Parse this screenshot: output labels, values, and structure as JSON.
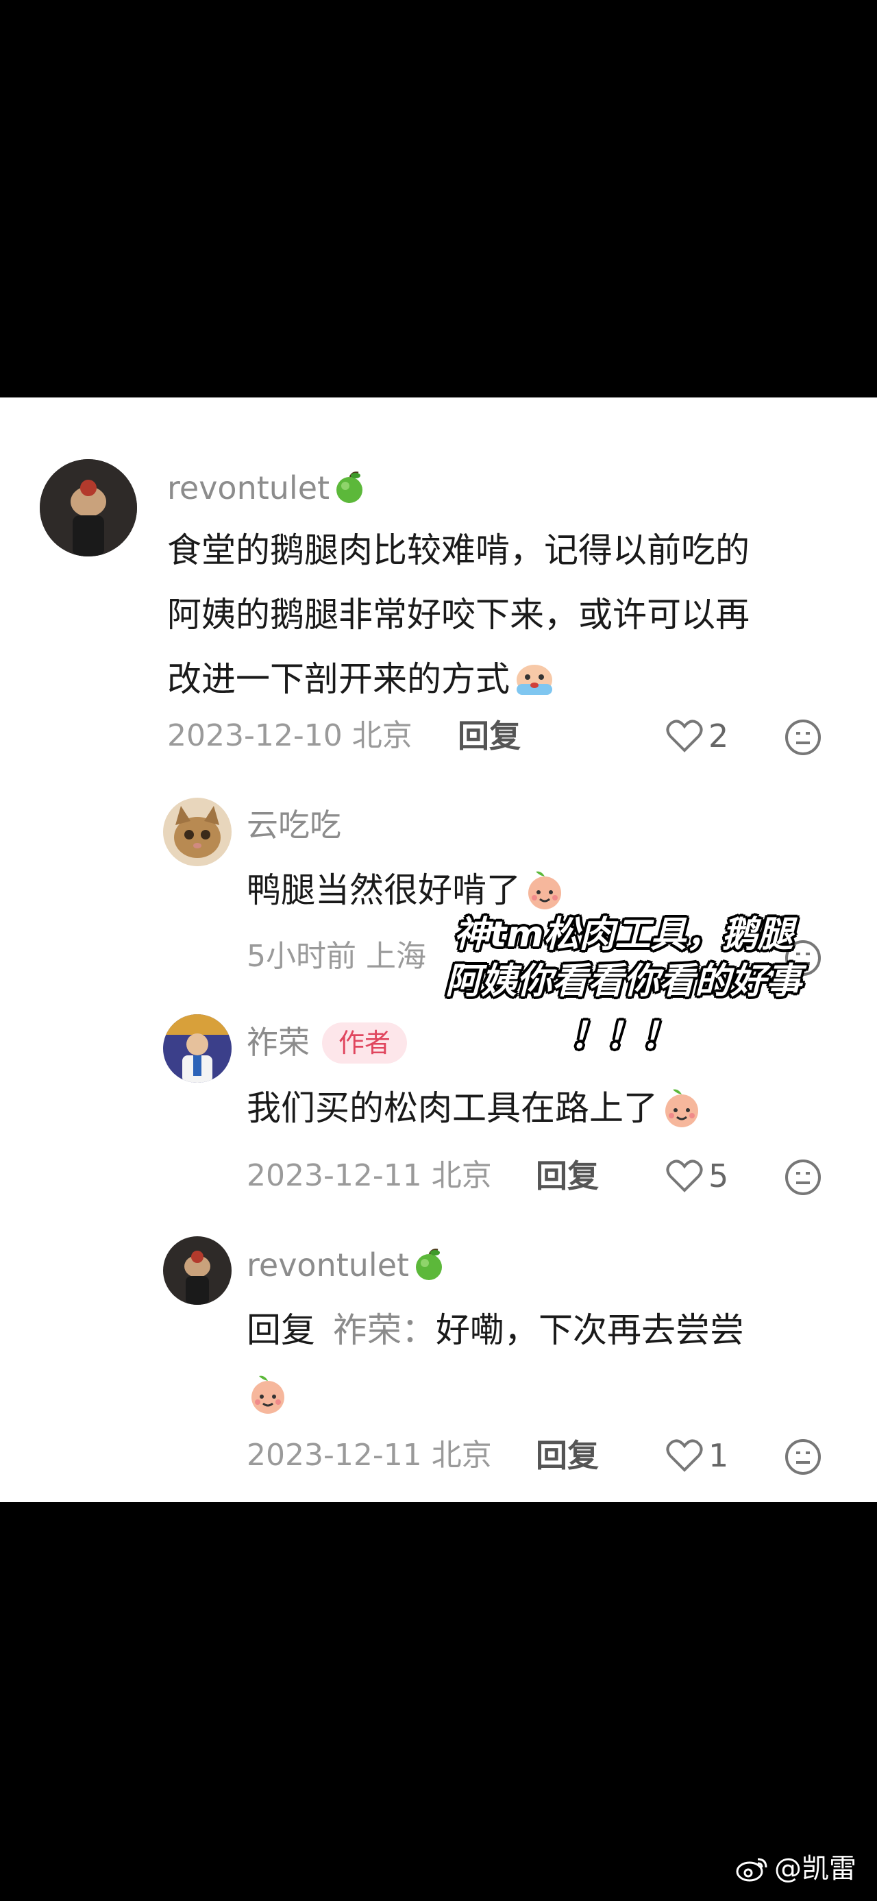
{
  "colors": {
    "background": "#000000",
    "panel": "#ffffff",
    "username": "#8c8c8c",
    "body_text": "#1a1a1a",
    "meta": "#9a9a9a",
    "author_badge_bg": "#fde6ea",
    "author_badge_text": "#e0465e"
  },
  "comments": [
    {
      "username": "revontulet",
      "username_icon": "green-apple-icon",
      "text_lines": [
        "食堂的鹅腿肉比较难啃，记得以前吃的",
        "阿姨的鹅腿非常好咬下来，或许可以再",
        "改进一下剖开来的方式"
      ],
      "sticker": "crying-face-sticker",
      "date_location": "2023-12-10 北京",
      "reply_label": "回复",
      "likes": "2"
    },
    {
      "username": "云吃吃",
      "text_lines": [
        "鸭腿当然很好啃了"
      ],
      "sticker": "peach-face-sticker",
      "date_location": "5小时前 上海"
    },
    {
      "username": "祚荣",
      "author_badge": "作者",
      "text_lines": [
        "我们买的松肉工具在路上了"
      ],
      "sticker": "peach-face-sticker",
      "date_location": "2023-12-11 北京",
      "reply_label": "回复",
      "likes": "5"
    },
    {
      "username": "revontulet",
      "username_icon": "green-apple-icon",
      "reply_prefix": "回复",
      "reply_target": "祚荣：",
      "text_lines": [
        "好嘞，下次再去尝尝"
      ],
      "sticker": "peach-face-sticker",
      "date_location": "2023-12-11 北京",
      "reply_label": "回复",
      "likes": "1"
    }
  ],
  "overlay_caption": {
    "line1": "神tm松肉工具，鹅腿",
    "line2": "阿姨你看看你看的好事",
    "line3": "！！！"
  },
  "watermark": {
    "icon": "weibo-icon",
    "text": "@凯雷"
  }
}
